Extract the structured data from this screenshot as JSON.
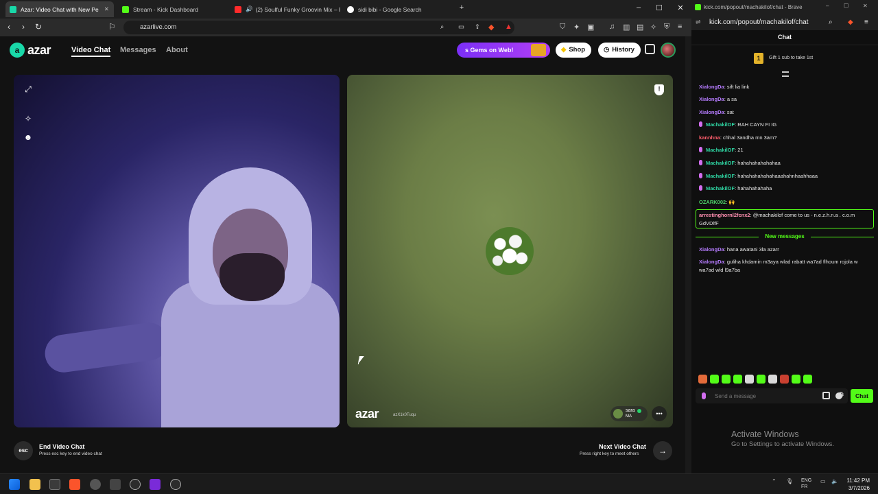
{
  "browser": {
    "tabs": [
      {
        "label": "Azar: Video Chat with New Pe",
        "active": true
      },
      {
        "label": "Stream - Kick Dashboard"
      },
      {
        "label": "(2) Soulful Funky Groovin Mix – R"
      },
      {
        "label": "sidi bibi - Google Search"
      }
    ],
    "url": "azarlive.com"
  },
  "azar": {
    "logo_text": "azar",
    "nav": {
      "video_chat": "Video Chat",
      "messages": "Messages",
      "about": "About"
    },
    "gems_label": "s Gems on Web!",
    "shop_label": "Shop",
    "history_label": "History",
    "watermark": "azar",
    "watermark_id": "azX1k0Tuqu",
    "peer": {
      "name": "sara",
      "country": "MA"
    },
    "end_key": "esc",
    "end_title": "End Video Chat",
    "end_sub": "Press esc key to end video chat",
    "next_title": "Next Video Chat",
    "next_sub": "Press right key to meet others"
  },
  "chat": {
    "window_title": "kick.com/popout/machakilof/chat - Brave",
    "url": "kick.com/popout/machakilof/chat",
    "header": "Chat",
    "sub_badge": "1",
    "sub_banner": "Gift 1 sub to take 1st",
    "messages": [
      {
        "user": "XialongDa",
        "text": ": sift lia link"
      },
      {
        "user": "XialongDa",
        "text": ": a sa"
      },
      {
        "user": "XialongDa",
        "text": ": sat"
      },
      {
        "user": "MachakilOF",
        "text": ": RAH CAYN FI IG"
      },
      {
        "user": "kannhna",
        "text": ": chhal 3andha mn 3am?"
      },
      {
        "user": "MachakilOF",
        "text": ": 21"
      },
      {
        "user": "MachakilOF",
        "text": ": hahahahahahahaa"
      },
      {
        "user": "MachakilOF",
        "text": ": hahahahahahahaaahahnhaahhaaa"
      },
      {
        "user": "MachakilOF",
        "text": ": hahahahahaha"
      },
      {
        "user": "OZARK002",
        "text": ": "
      },
      {
        "user": "arrestinghornl2fcnx2",
        "text": ": @machakilof come to us - n.e.z.h.n.a . c.o.m GdVDlfF"
      },
      {
        "user": "XialongDa",
        "text": ": hana awatani 3la azarr"
      },
      {
        "user": "XialongDa",
        "text": ": guliha khdamin m3aya wlad rabatt wa7ad flhoum rojola w wa7ad wld l9a7ba"
      }
    ],
    "new_messages_label": "New messages",
    "input_placeholder": "Send a message",
    "send_label": "Chat"
  },
  "colors": {
    "kick_green": "#53fc18",
    "xialongda": "#b67cff",
    "machakilof": "#2fd6a3",
    "kannhna": "#ff5d6c",
    "ozark": "#4fd66b",
    "arresting": "#ff8fb1"
  },
  "windows": {
    "activate_title": "Activate Windows",
    "activate_sub": "Go to Settings to activate Windows."
  },
  "taskbar": {
    "lang1": "ENG",
    "lang2": "FR",
    "time": "11:42 PM",
    "date": "3/7/2026"
  }
}
